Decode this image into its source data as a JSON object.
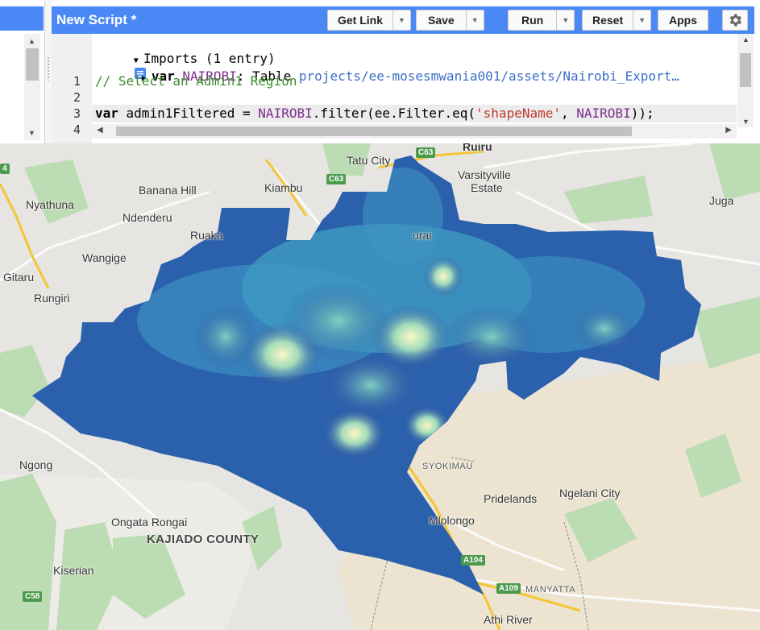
{
  "editor": {
    "title": "New Script *",
    "buttons": {
      "get_link": "Get Link",
      "save": "Save",
      "run": "Run",
      "reset": "Reset",
      "apps": "Apps"
    },
    "imports_header": "Imports (1 entry)",
    "import_entry": {
      "keyword": "var",
      "name": "NAIROBI",
      "type": ": Table",
      "path": "projects/ee-mosesmwania001/assets/Nairobi_Export…"
    },
    "line_numbers": [
      "1",
      "2",
      "3",
      "4"
    ],
    "lines": {
      "line1": "// Select an Admin1 Region",
      "line3": {
        "kw": "var",
        "lhs": " admin1Filtered = ",
        "obj": "NAIROBI",
        "mid": ".filter(ee.Filter.eq(",
        "str": "'shapeName'",
        "sep": ", ",
        "arg": "NAIROBI",
        "end": "));"
      }
    }
  },
  "map": {
    "places": {
      "tatu_city": "Tatu City",
      "ruiru": "Ruiru",
      "varsityville": "Varsityville",
      "estate": "Estate",
      "juga": "Juga",
      "banana_hill": "Banana Hill",
      "kiambu": "Kiambu",
      "nyathuna": "Nyathuna",
      "ndenderu": "Ndenderu",
      "ruaka": "Ruaka",
      "wangige": "Wangige",
      "gitaru": "Gitaru",
      "rungiri": "Rungiri",
      "ruai": "urai",
      "ngong": "Ngong",
      "syokimau": "SYOKIMAU",
      "pridelands": "Pridelands",
      "ngelani": "Ngelani City",
      "mlolongo": "Mlolongo",
      "ongata_rongai": "Ongata Rongai",
      "kajiado": "KAJIADO COUNTY",
      "kiserian": "Kiserian",
      "manyatta": "MANYATTA",
      "athi_river": "Athi River"
    },
    "road_shields": {
      "c63_top": "C63",
      "c63": "C63",
      "a104": "A104",
      "a109": "A109",
      "c58": "C58",
      "left4": "4"
    }
  }
}
